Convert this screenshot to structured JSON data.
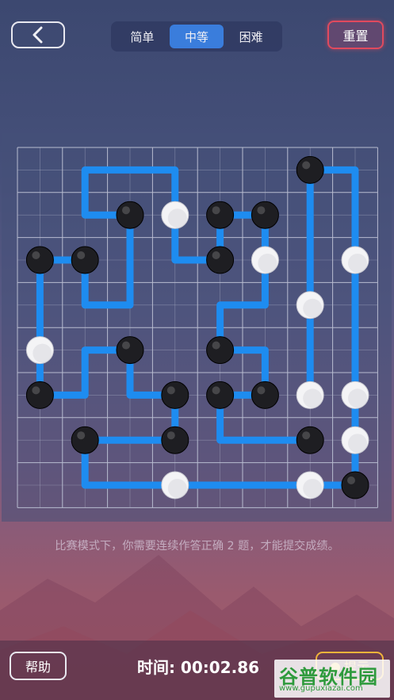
{
  "header": {
    "difficulty_tabs": [
      {
        "label": "简单",
        "active": false
      },
      {
        "label": "中等",
        "active": true
      },
      {
        "label": "困难",
        "active": false
      }
    ],
    "reset_label": "重置"
  },
  "board": {
    "grid": 8,
    "colors": {
      "line": "#1e8cf0",
      "grid": "#b8bcd0",
      "black": "#1e1e22",
      "white": "#f4f4f6"
    },
    "black_stones": [
      [
        6,
        0
      ],
      [
        2,
        1
      ],
      [
        4,
        1
      ],
      [
        5,
        1
      ],
      [
        0,
        2
      ],
      [
        1,
        2
      ],
      [
        4,
        2
      ],
      [
        2,
        4
      ],
      [
        4,
        4
      ],
      [
        0,
        5
      ],
      [
        3,
        5
      ],
      [
        4,
        5
      ],
      [
        5,
        5
      ],
      [
        1,
        6
      ],
      [
        3,
        6
      ],
      [
        6,
        6
      ],
      [
        7,
        7
      ]
    ],
    "white_stones": [
      [
        3,
        1
      ],
      [
        5,
        2
      ],
      [
        7,
        2
      ],
      [
        6,
        3
      ],
      [
        0,
        4
      ],
      [
        6,
        5
      ],
      [
        7,
        5
      ],
      [
        7,
        6
      ],
      [
        3,
        7
      ],
      [
        6,
        7
      ]
    ],
    "paths": [
      [
        [
          2,
          1
        ],
        [
          1,
          1
        ],
        [
          1,
          0
        ],
        [
          3,
          0
        ],
        [
          3,
          1
        ]
      ],
      [
        [
          2,
          1
        ],
        [
          2,
          3
        ],
        [
          1,
          3
        ],
        [
          1,
          2
        ]
      ],
      [
        [
          1,
          2
        ],
        [
          0,
          2
        ],
        [
          0,
          5
        ],
        [
          1,
          5
        ],
        [
          1,
          4
        ],
        [
          2,
          4
        ],
        [
          2,
          5
        ],
        [
          3,
          5
        ]
      ],
      [
        [
          3,
          1
        ],
        [
          3,
          2
        ],
        [
          4,
          2
        ],
        [
          4,
          1
        ],
        [
          5,
          1
        ],
        [
          5,
          2
        ]
      ],
      [
        [
          5,
          2
        ],
        [
          5,
          3
        ],
        [
          4,
          3
        ],
        [
          4,
          4
        ],
        [
          5,
          4
        ],
        [
          5,
          5
        ],
        [
          4,
          5
        ]
      ],
      [
        [
          4,
          5
        ],
        [
          4,
          6
        ],
        [
          6,
          6
        ]
      ],
      [
        [
          6,
          0
        ],
        [
          6,
          3
        ]
      ],
      [
        [
          6,
          3
        ],
        [
          6,
          5
        ]
      ],
      [
        [
          6,
          0
        ],
        [
          7,
          0
        ],
        [
          7,
          2
        ]
      ],
      [
        [
          7,
          2
        ],
        [
          7,
          5
        ]
      ],
      [
        [
          7,
          5
        ],
        [
          7,
          6
        ]
      ],
      [
        [
          7,
          6
        ],
        [
          7,
          7
        ]
      ],
      [
        [
          7,
          7
        ],
        [
          6,
          7
        ],
        [
          3,
          7
        ],
        [
          1,
          7
        ],
        [
          1,
          6
        ],
        [
          3,
          6
        ],
        [
          3,
          5
        ]
      ]
    ]
  },
  "hint_text": "比赛模式下，你需要连续作答正确 2 题，才能提交成绩。",
  "footer": {
    "help_label": "帮助",
    "timer_label": "时间: 00:02.86",
    "hint_label": "提示"
  },
  "watermark": {
    "title": "谷普软件园",
    "url": "www.gupuxiazai.com"
  }
}
